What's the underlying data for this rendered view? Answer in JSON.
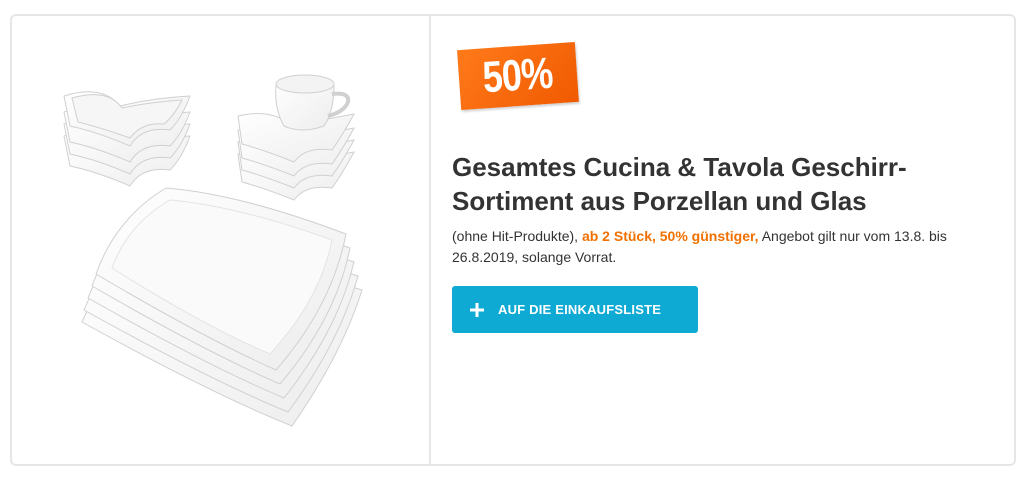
{
  "product": {
    "badge": "50%",
    "title": "Gesamtes Cucina & Tavola Geschirr-Sortiment aus Porzellan und Glas",
    "description": {
      "prefix": "(ohne Hit-Produkte), ",
      "highlight": "ab 2 Stück, 50% günstiger,",
      "suffix": " Angebot gilt nur vom 13.8. bis 26.8.2019, solange Vorrat."
    },
    "button": {
      "label": "AUF DIE EINKAUFSLISTE",
      "icon": "plus-icon"
    },
    "image": "white-porcelain-tableware-set"
  },
  "colors": {
    "badge": "#f05a00",
    "highlight": "#f07000",
    "button": "#0eaad4",
    "border": "#e6e6e6"
  }
}
